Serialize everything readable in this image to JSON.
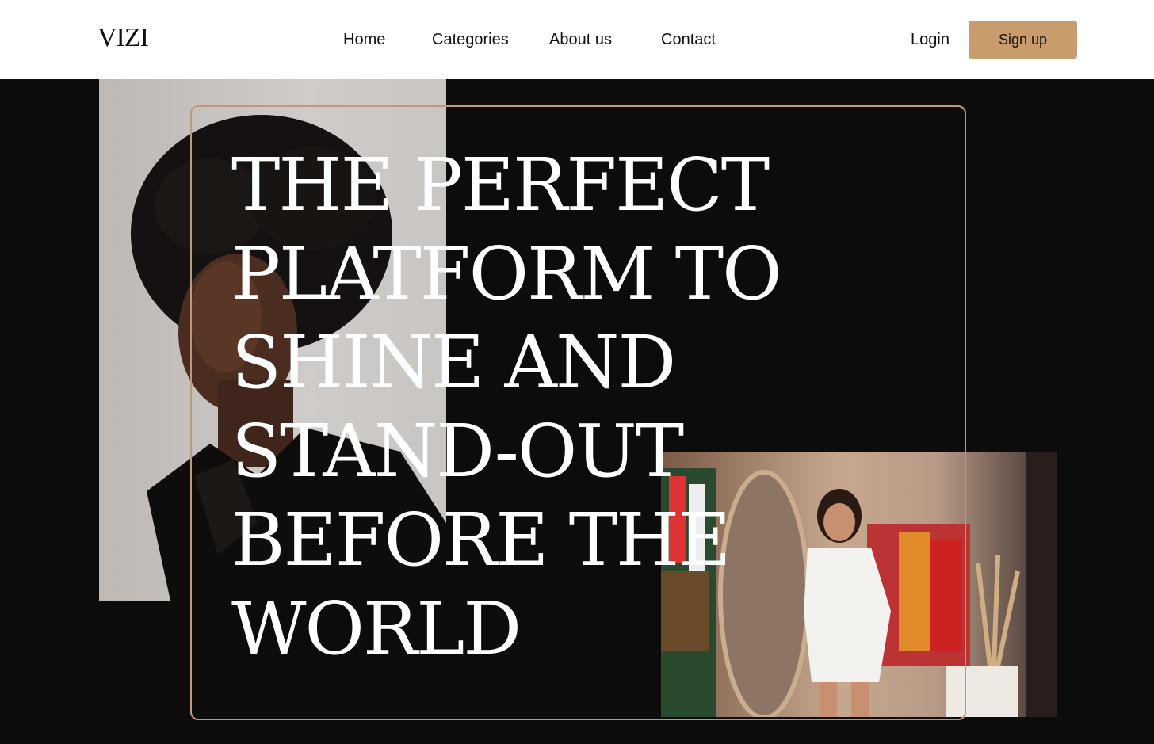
{
  "header": {
    "logo": "VIZI",
    "nav": [
      {
        "label": "Home"
      },
      {
        "label": "Categories"
      },
      {
        "label": "About us"
      },
      {
        "label": "Contact"
      }
    ],
    "login_label": "Login",
    "signup_label": "Sign up"
  },
  "hero": {
    "headline_lines": [
      "THE PERFECT",
      "PLATFORM TO",
      "SHINE AND",
      "STAND-OUT",
      "BEFORE THE",
      "WORLD"
    ]
  },
  "colors": {
    "accent": "#c99c6e",
    "frame": "#c2987a",
    "background": "#0e0c0b",
    "header_bg": "#ffffff"
  }
}
